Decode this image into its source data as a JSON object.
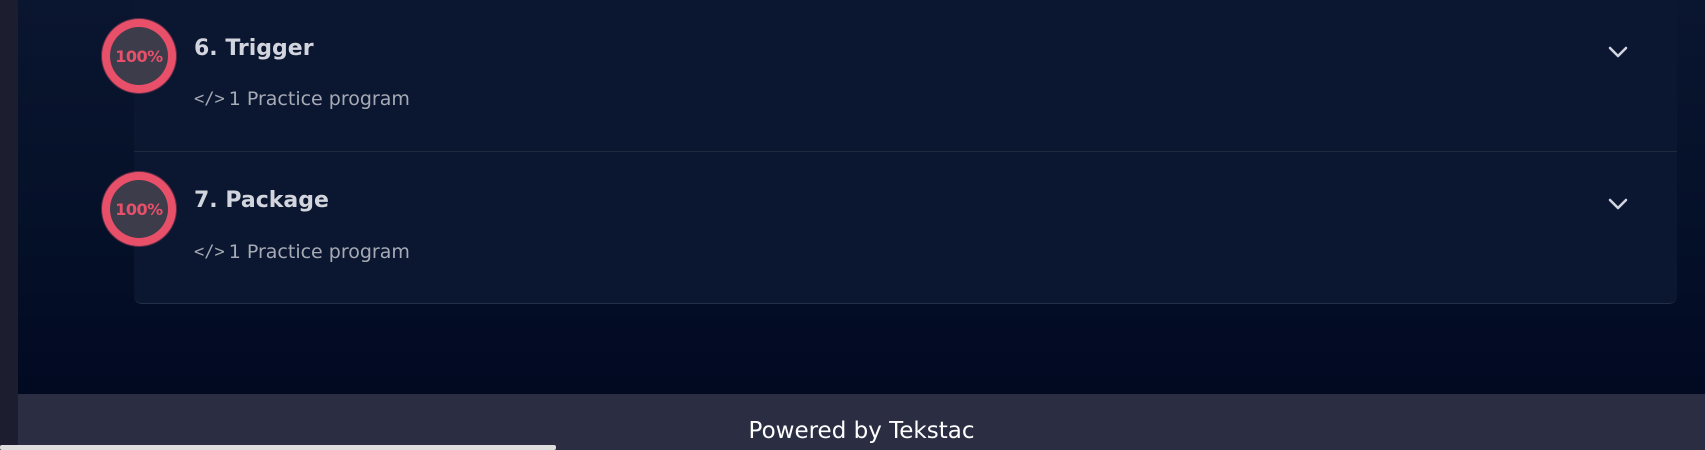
{
  "modules": [
    {
      "number_title": "6. Trigger",
      "progress_label": "100%",
      "practice_text": "1 Practice program",
      "code_icon_glyph": "</>",
      "icon": "chevron-down-icon"
    },
    {
      "number_title": "7. Package",
      "progress_label": "100%",
      "practice_text": "1 Practice program",
      "code_icon_glyph": "</>",
      "icon": "chevron-down-icon"
    }
  ],
  "footer": {
    "powered_by": "Powered by Tekstac"
  },
  "colors": {
    "page_background": "#070f23",
    "card_background": "#0b1730",
    "badge_ring": "#e8506a",
    "badge_inner": "#3d3c4b",
    "footer_background": "#2b2d43",
    "left_rail": "#1c1e30"
  }
}
